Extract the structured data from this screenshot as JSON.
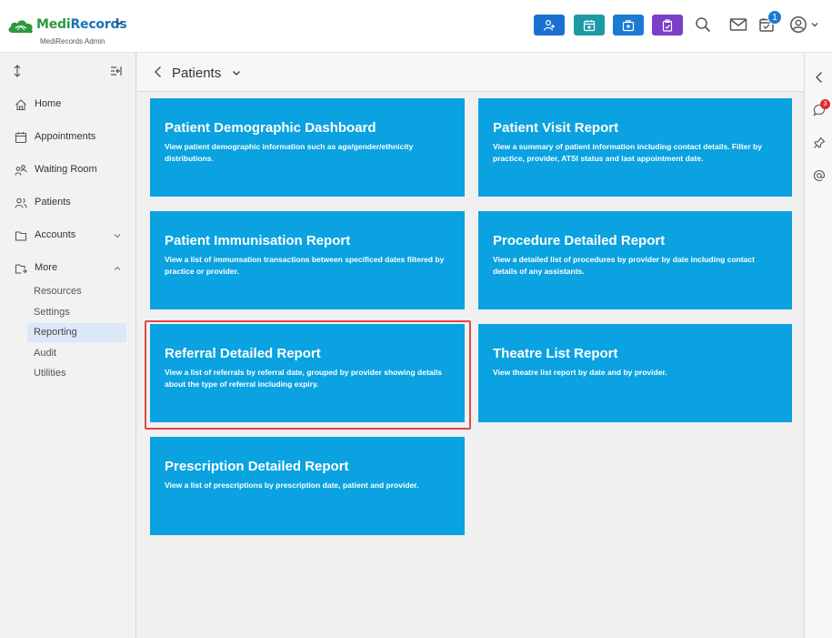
{
  "header": {
    "brand_medi": "Medi",
    "brand_records": "Records",
    "subtitle": "MediRecords Admin",
    "toolbar_buttons": [
      {
        "icon": "add-patient-icon",
        "color": "#1a6fd1"
      },
      {
        "icon": "calendar-add-icon",
        "color": "#1d9aa6"
      },
      {
        "icon": "medical-kit-icon",
        "color": "#1a7ad4"
      },
      {
        "icon": "clipboard-icon",
        "color": "#7a3fc9"
      }
    ],
    "notification_count": "1"
  },
  "sidebar": {
    "items": [
      {
        "label": "Home",
        "icon": "home-icon"
      },
      {
        "label": "Appointments",
        "icon": "calendar-icon"
      },
      {
        "label": "Waiting Room",
        "icon": "waiting-room-icon"
      },
      {
        "label": "Patients",
        "icon": "patients-icon"
      },
      {
        "label": "Accounts",
        "icon": "folder-icon"
      },
      {
        "label": "More",
        "icon": "folder-more-icon"
      }
    ],
    "sub_items": [
      "Resources",
      "Settings",
      "Reporting",
      "Audit",
      "Utilities"
    ],
    "active_sub_item": "Reporting"
  },
  "main": {
    "title": "Patients",
    "cards": [
      {
        "title": "Patient Demographic Dashboard",
        "desc": "View patient demographic information such as age/gender/ethnicity distributions."
      },
      {
        "title": "Patient Visit Report",
        "desc": "View a summary of patient information including contact details. Filter by practice, provider, ATSI status and last appointment date."
      },
      {
        "title": "Patient Immunisation Report",
        "desc": "View a list of immunsation transactions between specificed dates filtered by practice or provider."
      },
      {
        "title": "Procedure Detailed Report",
        "desc": "View a detailed list of procedures by provider by date including contact details of any assistants."
      },
      {
        "title": "Referral Detailed Report",
        "desc": "View a list of referrals by referral date, grouped by provider showing details about the type of referral including expiry."
      },
      {
        "title": "Theatre List Report",
        "desc": "View theatre list report by date and by provider."
      },
      {
        "title": "Prescription Detailed Report",
        "desc": "View a list of prescriptions by prescription date, patient and provider."
      }
    ],
    "card_color": "#0aa2e0",
    "highlight_color": "#e0484a"
  },
  "rail": {
    "chat_badge": "3"
  }
}
